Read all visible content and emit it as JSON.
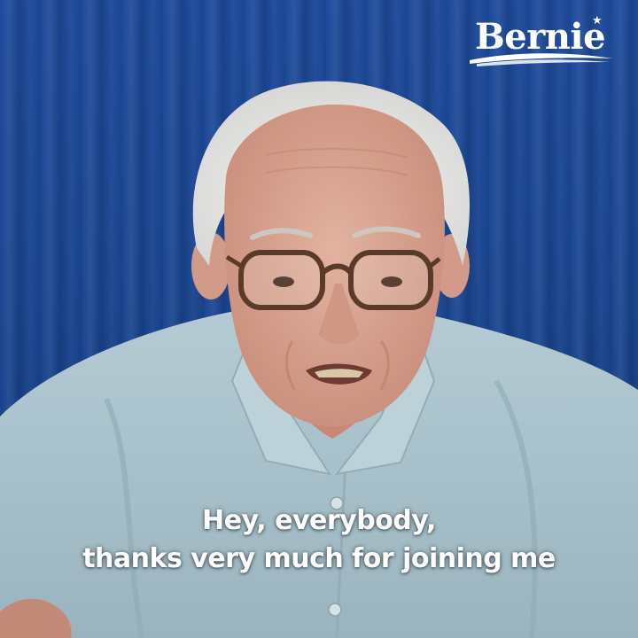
{
  "logo": {
    "text": "Bernie",
    "star_icon": "star-icon",
    "color": "#ffffff"
  },
  "caption": {
    "line1": "Hey, everybody,",
    "line2": "thanks very much for joining me"
  },
  "colors": {
    "curtain": "#1a4590",
    "shirt": "#a9c2cb",
    "hair": "#ececec",
    "skin": "#d9a896"
  }
}
